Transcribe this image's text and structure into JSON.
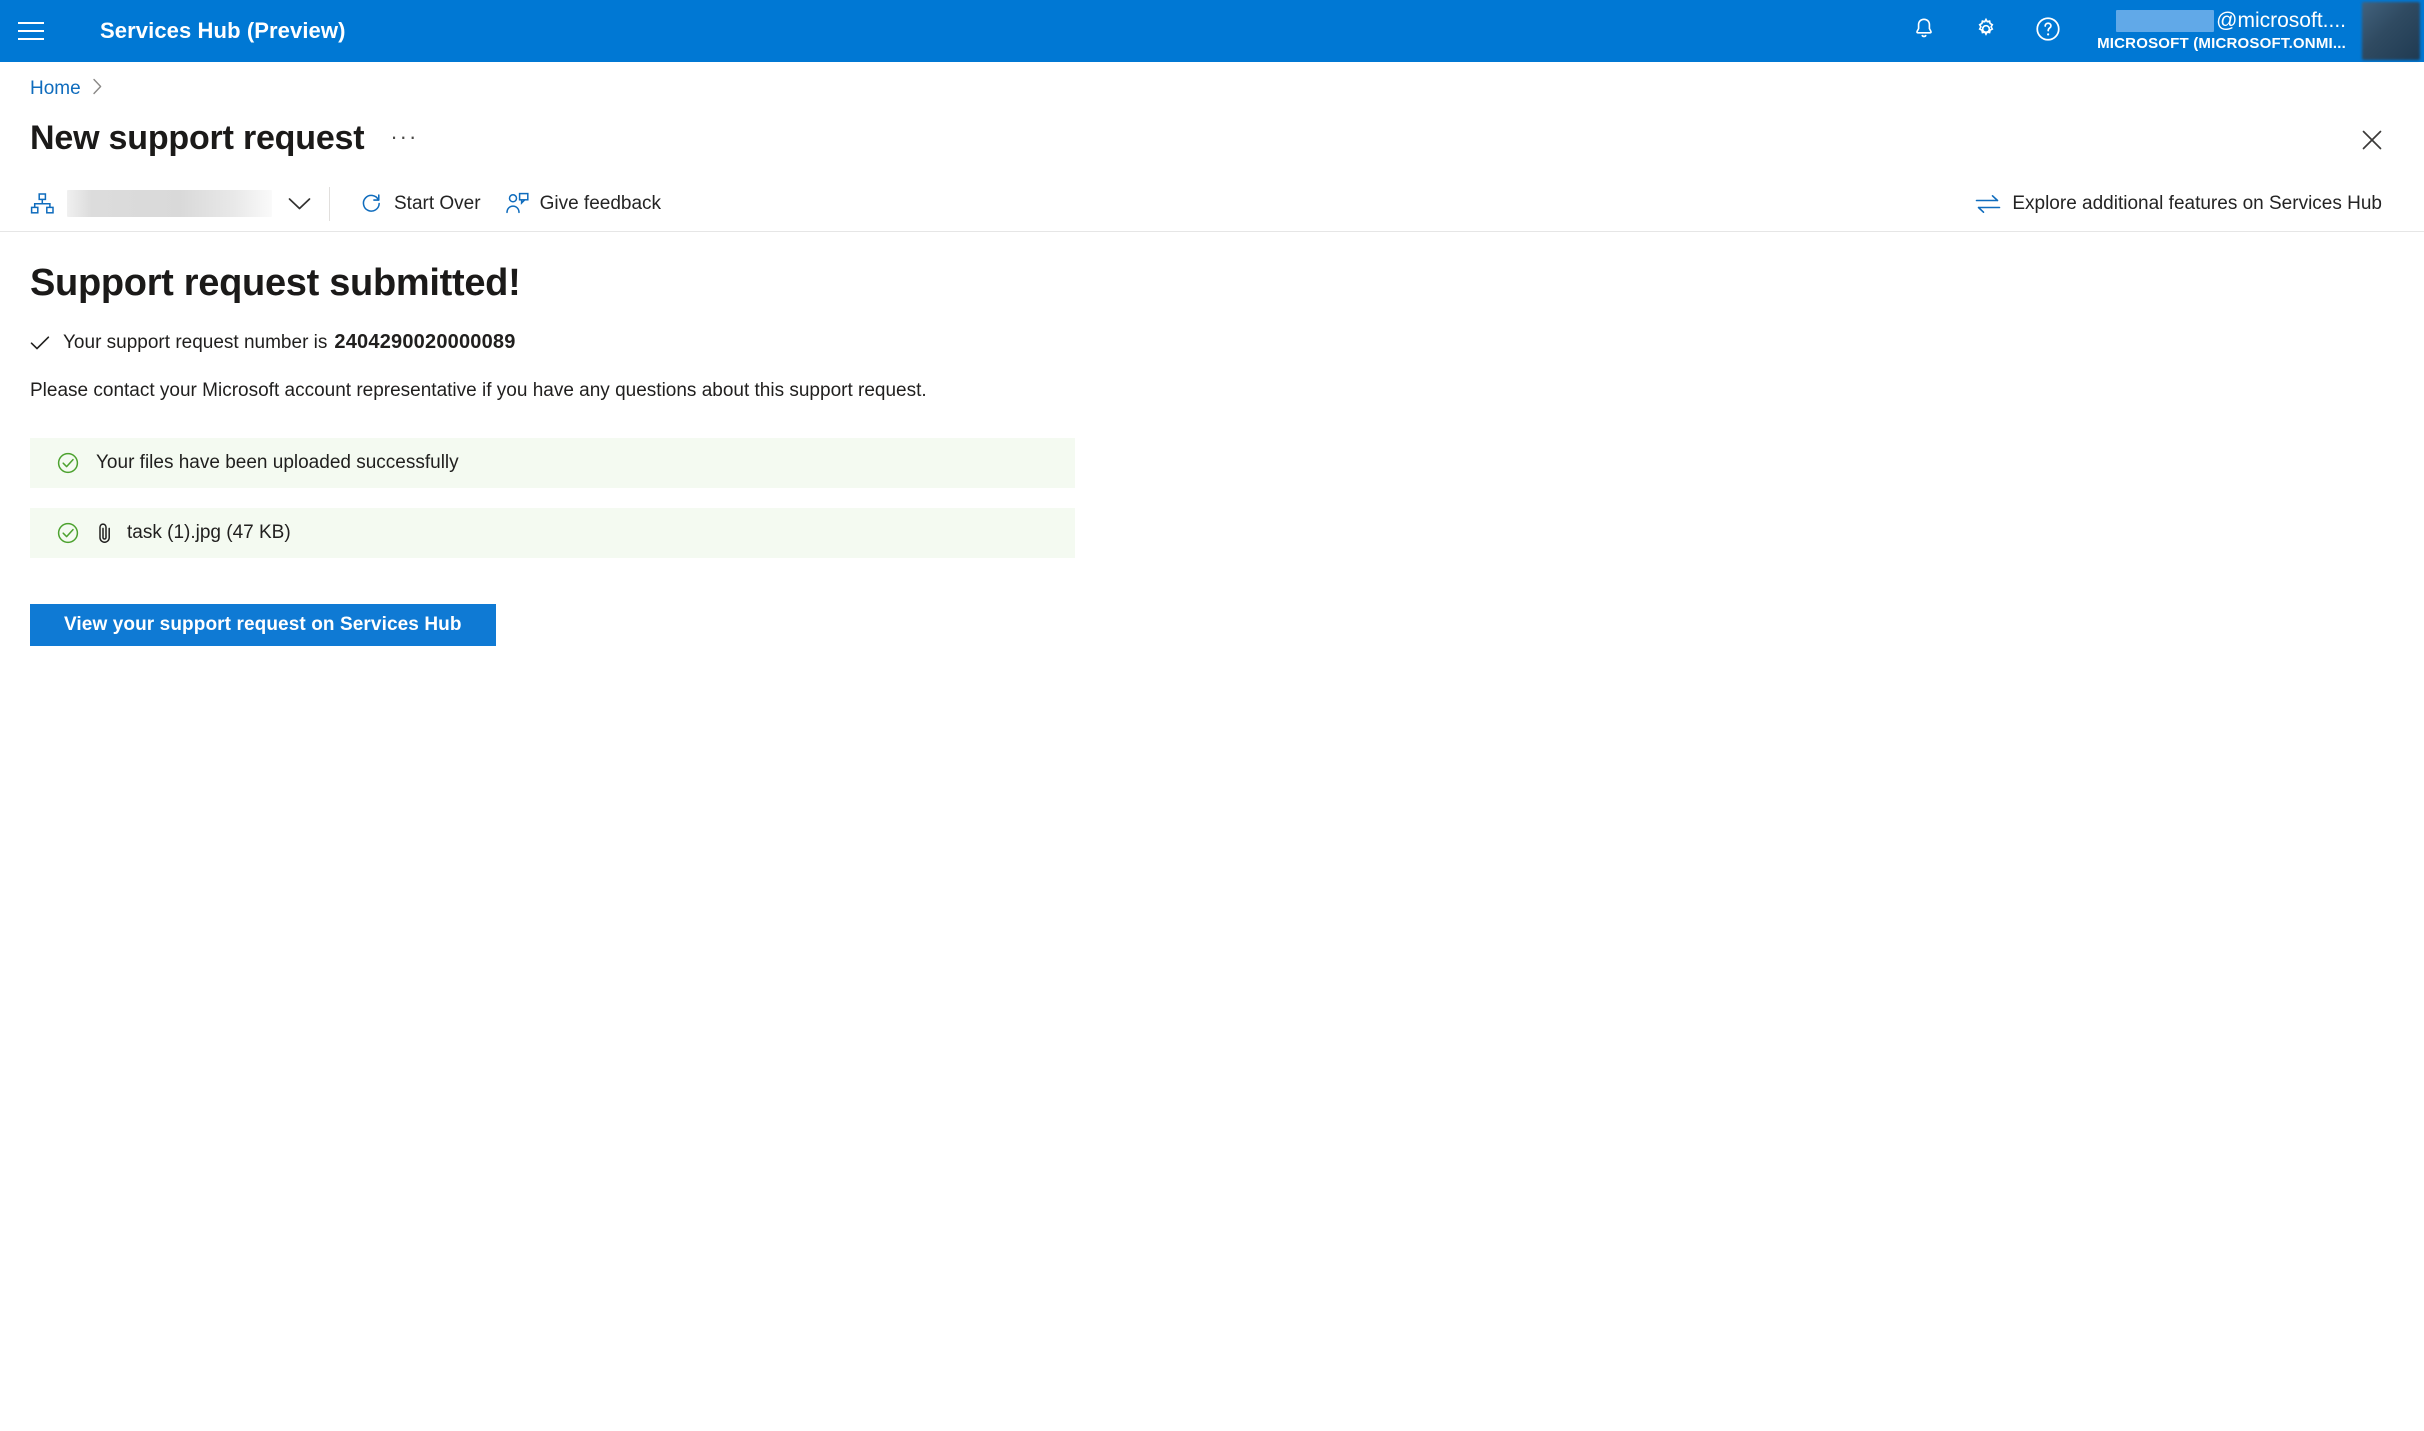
{
  "header": {
    "menu_icon": "hamburger-icon",
    "brand": "Services Hub (Preview)",
    "notifications_icon": "bell-icon",
    "settings_icon": "gear-icon",
    "help_icon": "help-icon",
    "user_email_suffix": "@microsoft....",
    "user_org": "MICROSOFT (MICROSOFT.ONMI...",
    "avatar_icon": "avatar"
  },
  "breadcrumb": {
    "home": "Home",
    "separator": "›"
  },
  "page": {
    "title": "New support request",
    "overflow": "···",
    "close_icon": "close-icon"
  },
  "commandbar": {
    "org_icon": "org-hierarchy-icon",
    "org_value": "",
    "chevron_icon": "chevron-down-icon",
    "start_over": "Start Over",
    "start_over_icon": "refresh-icon",
    "give_feedback": "Give feedback",
    "give_feedback_icon": "person-feedback-icon",
    "explore": "Explore additional features on Services Hub",
    "explore_icon": "swap-arrows-icon"
  },
  "main": {
    "heading": "Support request submitted!",
    "sr_check_icon": "checkmark-icon",
    "sr_label": "Your support request number is",
    "sr_number": "2404290020000089",
    "paragraph": "Please contact your Microsoft account representative if you have any questions about this support request.",
    "upload_status": {
      "icon": "check-circle-icon",
      "text": "Your files have been uploaded successfully"
    },
    "file": {
      "icon": "check-circle-icon",
      "attach_icon": "paperclip-icon",
      "name": "task (1).jpg (47 KB)"
    },
    "cta_label": "View your support request on Services Hub"
  },
  "colors": {
    "header_blue": "#0078D4",
    "link_blue": "#0F6CBD",
    "button_blue": "#0F7AD4",
    "success_green": "#4CA22F",
    "success_bg": "#F4FAF1"
  }
}
